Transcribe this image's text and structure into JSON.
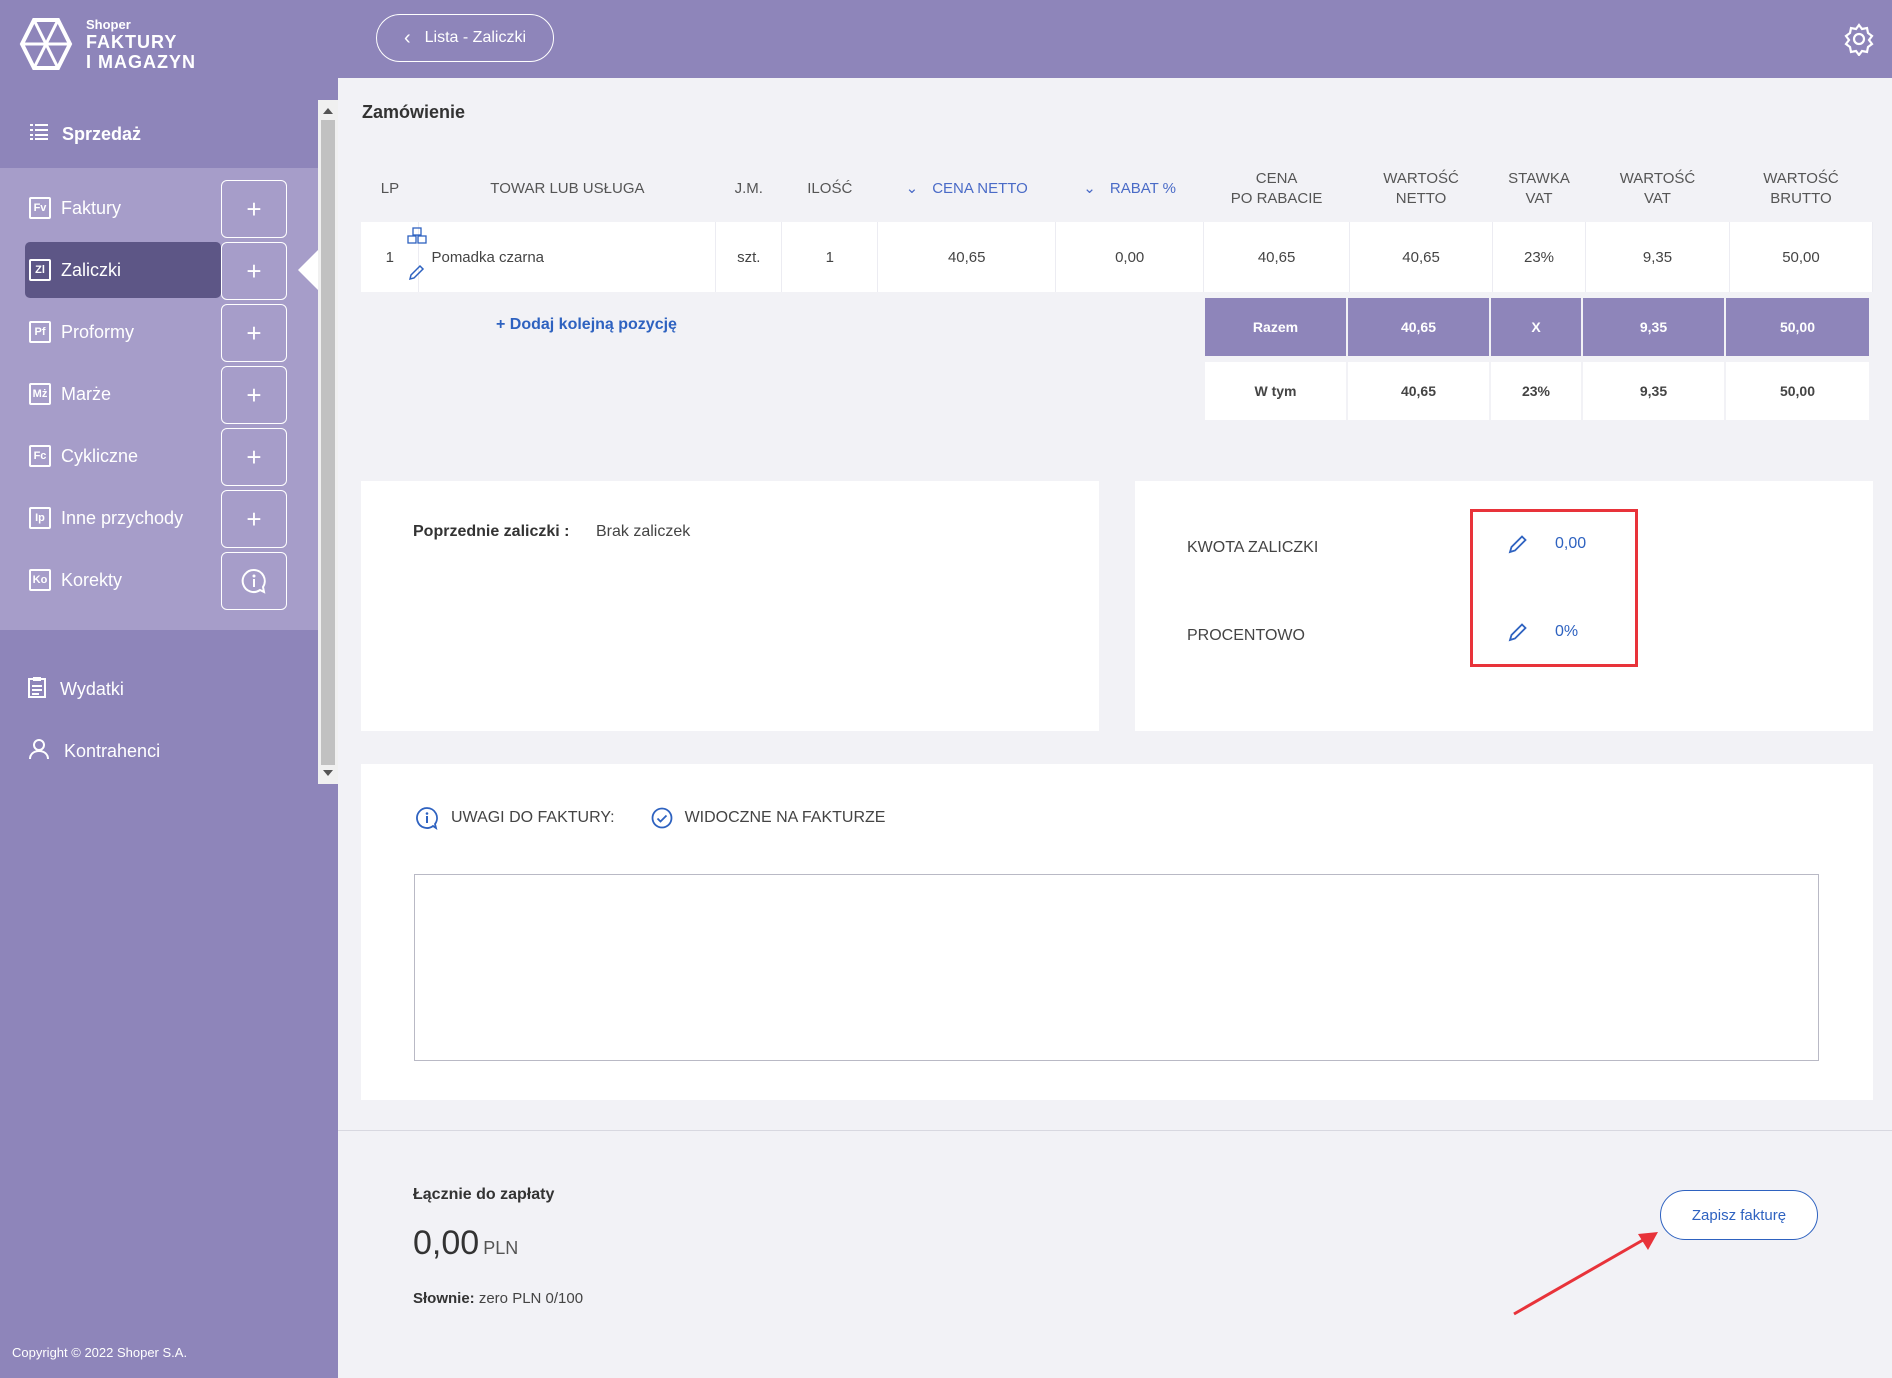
{
  "app": {
    "brand": "Shoper",
    "name_line1": "FAKTURY",
    "name_line2": "I MAGAZYN",
    "copyright": "Copyright © 2022 Shoper S.A."
  },
  "sidebar": {
    "section_title": "Sprzedaż",
    "sales_items": [
      {
        "label": "Faktury",
        "abbr": "Fv",
        "action": "+"
      },
      {
        "label": "Zaliczki",
        "abbr": "Zl",
        "action": "+",
        "active": true
      },
      {
        "label": "Proformy",
        "abbr": "Pf",
        "action": "+"
      },
      {
        "label": "Marże",
        "abbr": "Mż",
        "action": "+"
      },
      {
        "label": "Cykliczne",
        "abbr": "Fc",
        "action": "+"
      },
      {
        "label": "Inne przychody",
        "abbr": "Ip",
        "action": "+"
      },
      {
        "label": "Korekty",
        "abbr": "Ko",
        "action": "info"
      }
    ],
    "other_items": [
      {
        "label": "Wydatki"
      },
      {
        "label": "Kontrahenci"
      }
    ]
  },
  "topbar": {
    "back_label": "Lista - Zaliczki"
  },
  "main": {
    "section_title": "Zamówienie",
    "table": {
      "headers": {
        "lp": "LP",
        "name": "TOWAR LUB USŁUGA",
        "unit": "J.M.",
        "qty": "ILOŚĆ",
        "net_price": "CENA NETTO",
        "discount": "RABAT %",
        "price_after_1": "CENA",
        "price_after_2": "PO RABACIE",
        "net_value_1": "WARTOŚĆ",
        "net_value_2": "NETTO",
        "vat_rate_1": "STAWKA",
        "vat_rate_2": "VAT",
        "vat_value_1": "WARTOŚĆ",
        "vat_value_2": "VAT",
        "gross_1": "WARTOŚĆ",
        "gross_2": "BRUTTO"
      },
      "rows": [
        {
          "lp": "1",
          "name": "Pomadka czarna",
          "unit": "szt.",
          "qty": "1",
          "net_price": "40,65",
          "discount": "0,00",
          "price_after": "40,65",
          "net_value": "40,65",
          "vat_rate": "23%",
          "vat_value": "9,35",
          "gross": "50,00"
        }
      ],
      "add_position": "+ Dodaj kolejną pozycję"
    },
    "summary": {
      "total": {
        "label": "Razem",
        "net": "40,65",
        "rate": "X",
        "vat": "9,35",
        "gross": "50,00"
      },
      "including": {
        "label": "W tym",
        "net": "40,65",
        "rate": "23%",
        "vat": "9,35",
        "gross": "50,00"
      }
    },
    "previous": {
      "label": "Poprzednie zaliczki :",
      "value": "Brak zaliczek"
    },
    "advance": {
      "amount_label": "KWOTA ZALICZKI",
      "amount_value": "0,00",
      "percent_label": "PROCENTOWO",
      "percent_value": "0%"
    },
    "notes": {
      "label": "UWAGI DO FAKTURY:",
      "visible_label": "WIDOCZNE NA FAKTURZE",
      "value": ""
    },
    "total": {
      "label": "Łącznie do zapłaty",
      "amount": "0,00",
      "currency": "PLN",
      "words_label": "Słownie:",
      "words_value": "zero PLN 0/100"
    },
    "save_label": "Zapisz fakturę"
  },
  "colors": {
    "sidebar": "#8e85ba",
    "sidebar_light": "#a69dc9",
    "active": "#5d5686",
    "link": "#2e62c0",
    "highlight": "#e8333a"
  }
}
